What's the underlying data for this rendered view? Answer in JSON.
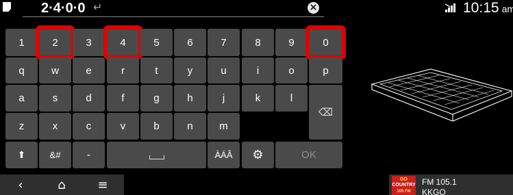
{
  "input": {
    "text": "2·4·0·0",
    "return_symbol": "↵",
    "clear_symbol": "×"
  },
  "status": {
    "time": "10:15",
    "ampm": "am"
  },
  "keyboard": {
    "row1": [
      "1",
      "2",
      "3",
      "4",
      "5",
      "6",
      "7",
      "8",
      "9",
      "0"
    ],
    "row2": [
      "q",
      "w",
      "e",
      "r",
      "t",
      "y",
      "u",
      "i",
      "o",
      "p"
    ],
    "row3": [
      "a",
      "s",
      "d",
      "f",
      "g",
      "h",
      "j",
      "k",
      "l"
    ],
    "row4": [
      "z",
      "x",
      "c",
      "v",
      "b",
      "n",
      "m"
    ],
    "shift_label": "⬆",
    "symbols_label": "&#",
    "dash_label": "-",
    "accents_label": "ÀÁÂ",
    "settings_glyph": "⚙",
    "ok_label": "OK",
    "backspace_glyph": "⌫",
    "highlighted_keys": [
      "2",
      "4",
      "0"
    ]
  },
  "nav": {
    "back": "‹",
    "home": "⌂",
    "menu": "≡"
  },
  "media": {
    "logo_line1": "GO",
    "logo_line2": "COUNTRY",
    "logo_line3": "105 FM",
    "frequency": "FM 105.1",
    "callsign": "KKGO"
  }
}
